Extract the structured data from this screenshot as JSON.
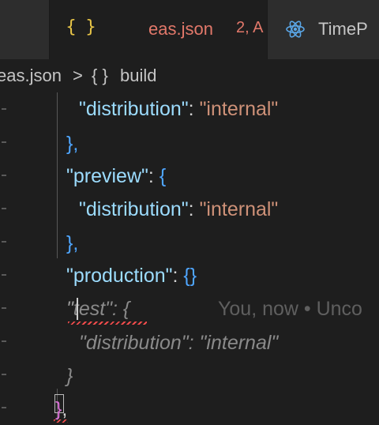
{
  "tabs": {
    "active": {
      "icon": "{ }",
      "name": "eas.json",
      "badge": "2, A"
    },
    "other": {
      "name": "TimeP"
    }
  },
  "breadcrumb": {
    "file": "eas.json",
    "sep": ">",
    "icon": "{ }",
    "node": "build"
  },
  "code": {
    "l1_key": "\"distribution\"",
    "l1_colon": ": ",
    "l1_val": "\"internal\"",
    "l2": "},",
    "l3_key": "\"preview\"",
    "l3_colon": ": ",
    "l3_brace": "{",
    "l4_key": "\"distribution\"",
    "l4_colon": ": ",
    "l4_val": "\"internal\"",
    "l5": "},",
    "l6_key": "\"production\"",
    "l6_colon": ": ",
    "l6_val": "{}",
    "l7_quote": "\"",
    "l7_ghost": "test\": {",
    "l7_blame": "You, now • Unco",
    "l8_ghost": "\"distribution\": \"internal\"",
    "l9_ghost": "}",
    "l10_brace": "}",
    "l10_comma": ","
  },
  "colors": {
    "key": "#9cdcfe",
    "string": "#ce9178",
    "bracket": "#4fa6ff",
    "error": "#f14c4c",
    "modified": "#e2786a"
  }
}
